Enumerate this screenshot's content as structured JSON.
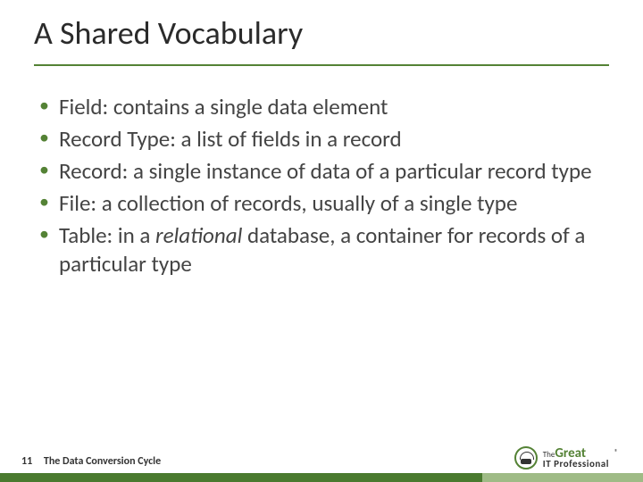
{
  "title": "A Shared Vocabulary",
  "bullets": [
    {
      "text": "Field: contains a single data element"
    },
    {
      "text": "Record Type: a list of fields in a record"
    },
    {
      "text": "Record: a single instance of data of a particular record type"
    },
    {
      "text_before": "File: a collection of records, usually of a single type"
    },
    {
      "text_before": "Table: in a ",
      "em": "relational",
      "text_after": " database, a container for records of a particular type"
    }
  ],
  "footer": {
    "page": "11",
    "caption": "The Data Conversion Cycle"
  },
  "logo": {
    "line1": "The",
    "line2": "Great",
    "line3": "IT Professional",
    "reg": "®"
  }
}
